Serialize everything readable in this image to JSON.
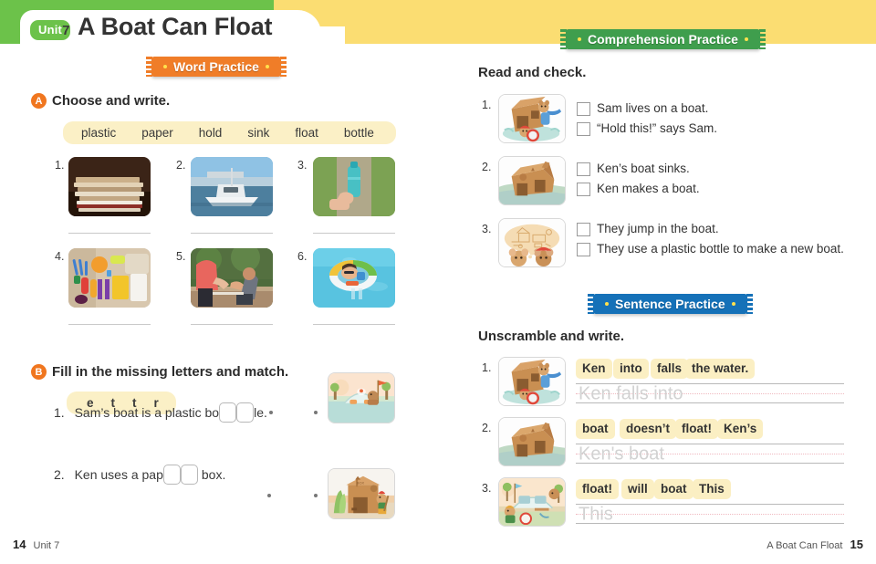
{
  "header": {
    "unit_label": "Unit",
    "unit_number": "7",
    "title": "A Boat Can Float"
  },
  "banners": {
    "word_practice": "Word Practice",
    "comprehension_practice": "Comprehension Practice",
    "sentence_practice": "Sentence Practice"
  },
  "section_a": {
    "letter": "A",
    "heading": "Choose and write.",
    "word_bank": [
      "plastic",
      "paper",
      "hold",
      "sink",
      "float",
      "bottle"
    ],
    "items": [
      {
        "num": "1.",
        "image": "stack-of-paper-photo"
      },
      {
        "num": "2.",
        "image": "boat-on-water-photo"
      },
      {
        "num": "3.",
        "image": "hand-holding-bottle-photo"
      },
      {
        "num": "4.",
        "image": "plastic-utensils-photo"
      },
      {
        "num": "5.",
        "image": "hand-holding-help-photo"
      },
      {
        "num": "6.",
        "image": "child-floating-ring-photo"
      }
    ]
  },
  "section_b": {
    "letter": "B",
    "heading": "Fill in the missing letters and match.",
    "letter_bank": [
      "e",
      "t",
      "t",
      "r"
    ],
    "items": [
      {
        "num": "1.",
        "before": "Sam’s boat is a plastic bo",
        "after": "le.",
        "blanks": 2,
        "image": "plastic-bottle-boat-illustration"
      },
      {
        "num": "2.",
        "before": "Ken uses a pap",
        "after": "box.",
        "blanks": 2,
        "image": "paper-box-house-illustration"
      }
    ]
  },
  "read_and_check": {
    "heading": "Read and check.",
    "items": [
      {
        "num": "1.",
        "image": "boat-sinking-mice-illustration",
        "options": [
          "Sam lives on a boat.",
          "“Hold this!” says Sam."
        ]
      },
      {
        "num": "2.",
        "image": "cardboard-boat-illustration",
        "options": [
          "Ken’s boat sinks.",
          "Ken makes a boat."
        ]
      },
      {
        "num": "3.",
        "image": "mice-thinking-bubble-illustration",
        "options": [
          "They jump in the boat.",
          "They use a plastic bottle to make a new boat."
        ]
      }
    ]
  },
  "sentence_practice": {
    "heading": "Unscramble and write.",
    "items": [
      {
        "num": "1.",
        "image": "mice-on-sinking-boat-illustration",
        "chips": [
          "Ken",
          "into",
          "falls",
          "the water."
        ],
        "trace": "Ken falls into"
      },
      {
        "num": "2.",
        "image": "cardboard-boat-illustration",
        "chips": [
          "boat",
          "doesn’t",
          "float!",
          "Ken’s"
        ],
        "trace": "Ken's boat"
      },
      {
        "num": "3.",
        "image": "bottle-boat-scene-illustration",
        "chips": [
          "float!",
          "will",
          "boat",
          "This"
        ],
        "trace": "This"
      }
    ]
  },
  "footer": {
    "left_page_number": "14",
    "left_label": "Unit 7",
    "right_label": "A Boat Can Float",
    "right_page_number": "15"
  },
  "colors": {
    "green": "#6cc24a",
    "yellow": "#fbdd72",
    "orange": "#f07d28",
    "banner_green": "#3f9e4d",
    "banner_blue": "#1571b8",
    "wordbank": "#fbf0c6"
  }
}
